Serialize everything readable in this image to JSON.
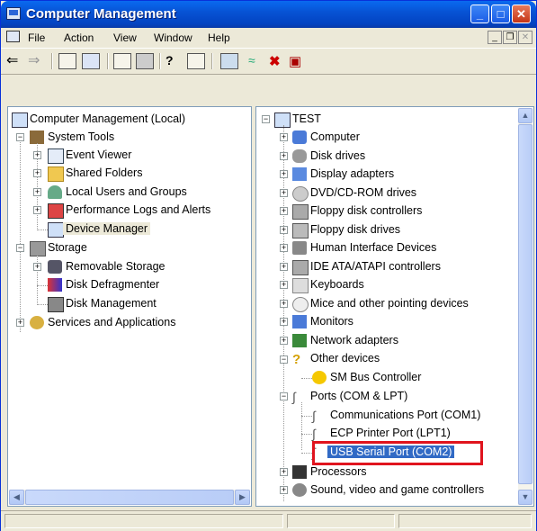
{
  "window": {
    "title": "Computer Management"
  },
  "menu": [
    {
      "label": "File",
      "key": "F"
    },
    {
      "label": "Action",
      "key": "A"
    },
    {
      "label": "View",
      "key": "V"
    },
    {
      "label": "Window",
      "key": "W"
    },
    {
      "label": "Help",
      "key": "H"
    }
  ],
  "left_tree": {
    "root": "Computer Management (Local)",
    "system_tools": "System Tools",
    "event_viewer": "Event Viewer",
    "shared_folders": "Shared Folders",
    "local_users": "Local Users and Groups",
    "perf_logs": "Performance Logs and Alerts",
    "device_manager": "Device Manager",
    "storage": "Storage",
    "removable": "Removable Storage",
    "defrag": "Disk Defragmenter",
    "disk_mgmt": "Disk Management",
    "services": "Services and Applications"
  },
  "right_tree": {
    "root": "TEST",
    "computer": "Computer",
    "disk_drives": "Disk drives",
    "display": "Display adapters",
    "dvd": "DVD/CD-ROM drives",
    "floppy_ctrl": "Floppy disk controllers",
    "floppy_drv": "Floppy disk drives",
    "hid": "Human Interface Devices",
    "ide": "IDE ATA/ATAPI controllers",
    "keyboards": "Keyboards",
    "mice": "Mice and other pointing devices",
    "monitors": "Monitors",
    "network": "Network adapters",
    "other": "Other devices",
    "sm_bus": "SM Bus Controller",
    "ports": "Ports (COM & LPT)",
    "com1": "Communications Port (COM1)",
    "lpt1": "ECP Printer Port (LPT1)",
    "com2": "USB Serial Port (COM2)",
    "processors": "Processors",
    "sound": "Sound, video and game controllers"
  },
  "colors": {
    "highlight": "#316ac5",
    "annotation_box": "#e0141e",
    "title_blue": "#0753d5"
  }
}
